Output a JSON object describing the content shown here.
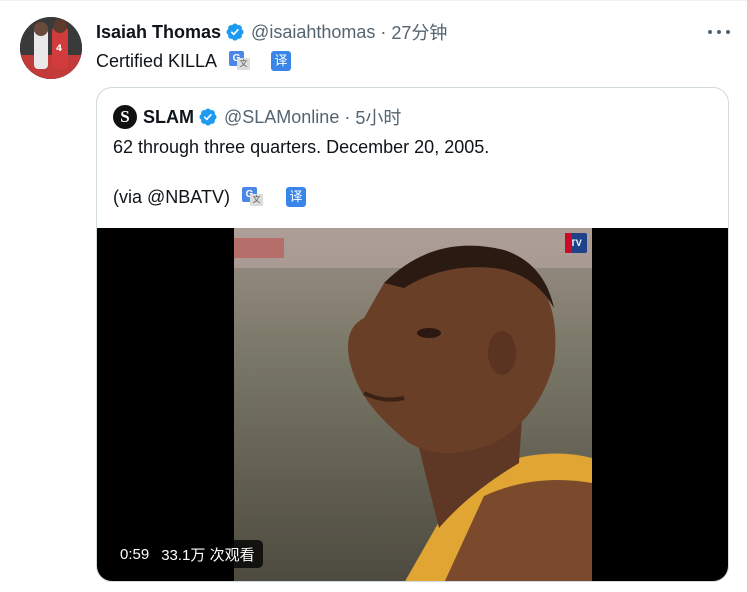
{
  "tweet": {
    "author_name": "Isaiah Thomas",
    "author_handle": "@isaiahthomas",
    "separator": "·",
    "time": "27分钟",
    "text": "Certified KILLA",
    "translate_label": "译",
    "google_translate_label": "G"
  },
  "quoted_tweet": {
    "author_name": "SLAM",
    "logo_letter": "S",
    "author_handle": "@SLAMonline",
    "separator": "·",
    "time": "5小时",
    "text_line1": "62 through three quarters. December 20, 2005.",
    "text_line2": "(via @NBATV)",
    "translate_label": "译",
    "google_translate_label": "G",
    "video": {
      "watermark": "TV",
      "duration": "0:59",
      "views": "33.1万 次观看"
    }
  },
  "colors": {
    "verified": "#1d9bf0",
    "secondary_text": "#536471",
    "translate": "#3a86e8",
    "border": "#cfd9de"
  },
  "icons": [
    "verified-badge-icon",
    "more-icon",
    "google-translate-icon",
    "translate-icon",
    "nba-tv-icon"
  ]
}
